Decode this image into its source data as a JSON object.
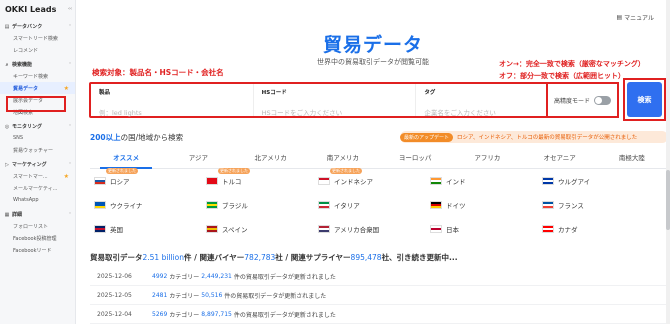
{
  "sidebar": {
    "brand": "OKKI Leads",
    "collapse_icon": "chevron-left-icon",
    "sections": [
      {
        "label": "データバンク",
        "icon": "database-icon",
        "items": [
          {
            "label": "スマートリード検索",
            "active": false,
            "star": false
          },
          {
            "label": "レコメンド",
            "active": false,
            "star": false
          }
        ]
      },
      {
        "label": "検索機能",
        "icon": "search-icon",
        "items": [
          {
            "label": "キーワード検索",
            "active": false,
            "star": false
          },
          {
            "label": "貿易データ",
            "active": true,
            "star": true
          },
          {
            "label": "展示会データ",
            "active": false,
            "star": false
          },
          {
            "label": "地図検索",
            "active": false,
            "star": false
          }
        ]
      },
      {
        "label": "モニタリング",
        "icon": "monitor-icon",
        "items": [
          {
            "label": "SNS",
            "active": false,
            "star": false
          },
          {
            "label": "貿易ウォッチャー",
            "active": false,
            "star": false
          }
        ]
      },
      {
        "label": "マーケティング",
        "icon": "megaphone-icon",
        "items": [
          {
            "label": "スマートマー...",
            "active": false,
            "star": true
          },
          {
            "label": "メールマーケティ...",
            "active": false,
            "star": false
          },
          {
            "label": "WhatsApp",
            "active": false,
            "star": false
          }
        ]
      },
      {
        "label": "詳細",
        "icon": "grid-icon",
        "items": [
          {
            "label": "フォローリスト",
            "active": false,
            "star": false
          },
          {
            "label": "Facebook投稿管理",
            "active": false,
            "star": false
          },
          {
            "label": "Facebookリード",
            "active": false,
            "star": false
          }
        ]
      }
    ]
  },
  "header": {
    "manual_label": "マニュアル",
    "title": "貿易データ",
    "subtitle": "世界中の貿易取引データが閲覧可能"
  },
  "annotations": {
    "left": "検索対象：製品名・HSコード・会社名",
    "right_line1": "オン→：完全一致で検索（厳密なマッチング）",
    "right_line2": "オフ：部分一致で検索（広範囲ヒット）"
  },
  "search": {
    "product_label": "製品",
    "product_placeholder": "例：led lights",
    "hs_label": "HSコード",
    "hs_placeholder": "HSコードをご入力ください",
    "tag_label": "タグ",
    "tag_placeholder": "企業名をご入力ください",
    "precision_label": "高精度モード",
    "precision_on": false,
    "button_label": "検索"
  },
  "countries_header": {
    "count": "200以上",
    "rest": "の国/地域から検索"
  },
  "update_bar": {
    "badge": "最新のアップデート",
    "text": "ロシア、インドネシア、トルコの最新の貿易取引データが公開されました"
  },
  "region_tabs": [
    {
      "label": "オススメ",
      "active": true
    },
    {
      "label": "アジア",
      "active": false
    },
    {
      "label": "北アメリカ",
      "active": false
    },
    {
      "label": "南アメリカ",
      "active": false
    },
    {
      "label": "ヨーロッパ",
      "active": false
    },
    {
      "label": "アフリカ",
      "active": false
    },
    {
      "label": "オセアニア",
      "active": false
    },
    {
      "label": "南極大陸",
      "active": false
    }
  ],
  "countries": [
    {
      "name": "ロシア",
      "tag": "更新されました",
      "colors": [
        "#ffffff",
        "#1c57a5",
        "#d52b1e"
      ]
    },
    {
      "name": "トルコ",
      "tag": "更新されました",
      "colors": [
        "#e30a17",
        "#e30a17",
        "#e30a17"
      ]
    },
    {
      "name": "インドネシア",
      "tag": "更新されました",
      "colors": [
        "#ce1126",
        "#ffffff",
        "#ffffff"
      ]
    },
    {
      "name": "インド",
      "tag": "",
      "colors": [
        "#ff9933",
        "#ffffff",
        "#138808"
      ]
    },
    {
      "name": "ウルグアイ",
      "tag": "",
      "colors": [
        "#0038a8",
        "#ffffff",
        "#0038a8"
      ]
    },
    {
      "name": "ウクライナ",
      "tag": "",
      "colors": [
        "#0057b7",
        "#0057b7",
        "#ffd700"
      ]
    },
    {
      "name": "ブラジル",
      "tag": "",
      "colors": [
        "#009c3b",
        "#ffdf00",
        "#009c3b"
      ]
    },
    {
      "name": "イタリア",
      "tag": "",
      "colors": [
        "#009246",
        "#ffffff",
        "#ce2b37"
      ]
    },
    {
      "name": "ドイツ",
      "tag": "",
      "colors": [
        "#000000",
        "#dd0000",
        "#ffce00"
      ]
    },
    {
      "name": "フランス",
      "tag": "",
      "colors": [
        "#0055a4",
        "#ffffff",
        "#ef4135"
      ]
    },
    {
      "name": "英国",
      "tag": "",
      "colors": [
        "#012169",
        "#c8102e",
        "#012169"
      ]
    },
    {
      "name": "スペイン",
      "tag": "",
      "colors": [
        "#aa151b",
        "#f1bf00",
        "#aa151b"
      ]
    },
    {
      "name": "アメリカ合衆国",
      "tag": "",
      "colors": [
        "#b22234",
        "#ffffff",
        "#3c3b6e"
      ]
    },
    {
      "name": "日本",
      "tag": "",
      "colors": [
        "#ffffff",
        "#bc002d",
        "#ffffff"
      ]
    },
    {
      "name": "カナダ",
      "tag": "",
      "colors": [
        "#ff0000",
        "#ffffff",
        "#ff0000"
      ]
    }
  ],
  "stats": {
    "prefix": "貿易取引データ",
    "records": "2.51 billion",
    "mid1": "件 / 関連バイヤー",
    "buyers": "782,783",
    "mid2": "社 / 関連サプライヤー",
    "suppliers": "895,478",
    "suffix": "社、引き続き更新中..."
  },
  "updates": [
    {
      "date": "2025-12-06",
      "count": "4992",
      "mid": "カテゴリー",
      "records": "2,449,231",
      "tail": "件の貿易取引データが更新されました"
    },
    {
      "date": "2025-12-05",
      "count": "2481",
      "mid": "カテゴリー",
      "records": "50,516",
      "tail": "件の貿易取引データが更新されました"
    },
    {
      "date": "2025-12-04",
      "count": "5269",
      "mid": "カテゴリー",
      "records": "8,897,715",
      "tail": "件の貿易取引データが更新されました"
    }
  ]
}
